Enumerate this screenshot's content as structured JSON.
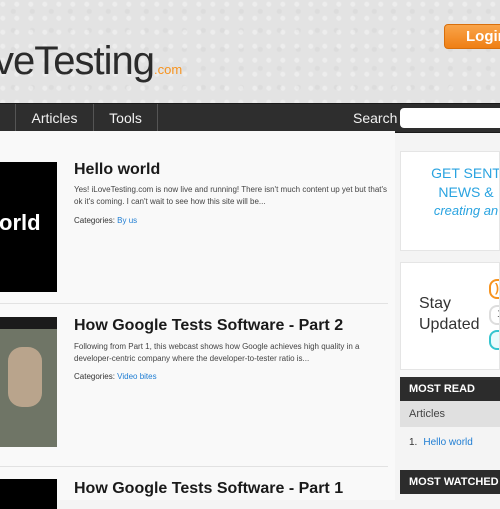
{
  "header": {
    "logo_text": "veTesting",
    "logo_suffix": ".com",
    "login_label": "Login"
  },
  "nav": {
    "items": [
      {
        "label": ""
      },
      {
        "label": "Articles"
      },
      {
        "label": "Tools"
      }
    ],
    "search_label": "Search",
    "search_value": ""
  },
  "posts": [
    {
      "title": "Hello world",
      "excerpt": "Yes! iLoveTesting.com is now live and running! There isn't much content up yet but that's ok it's coming. I can't wait to see how this site will be...",
      "categories_label": "Categories:",
      "categories": "By us",
      "thumb_text": "orld"
    },
    {
      "title": "How Google Tests Software - Part 2",
      "excerpt": "Following from Part 1, this webcast shows how Google achieves high quality in a developer-centric company where the developer-to-tester ratio is...",
      "categories_label": "Categories:",
      "categories": "Video bites"
    },
    {
      "title": "How Google Tests Software - Part 1"
    }
  ],
  "sidebar": {
    "promo": {
      "lines": [
        "GET SENT",
        "NEWS &",
        "creating an"
      ]
    },
    "stay_updated": {
      "line1": "Stay",
      "line2": "Updated"
    },
    "most_read": {
      "heading": "MOST READ",
      "tab": "Articles",
      "items": [
        {
          "index": "1.",
          "title": "Hello world"
        }
      ]
    },
    "most_watched": {
      "heading": "MOST WATCHED"
    }
  },
  "colors": {
    "accent_orange": "#f7931e",
    "link_blue": "#1e7dd3",
    "promo_blue": "#29a3e0",
    "nav_bg": "#2e2e2e"
  }
}
